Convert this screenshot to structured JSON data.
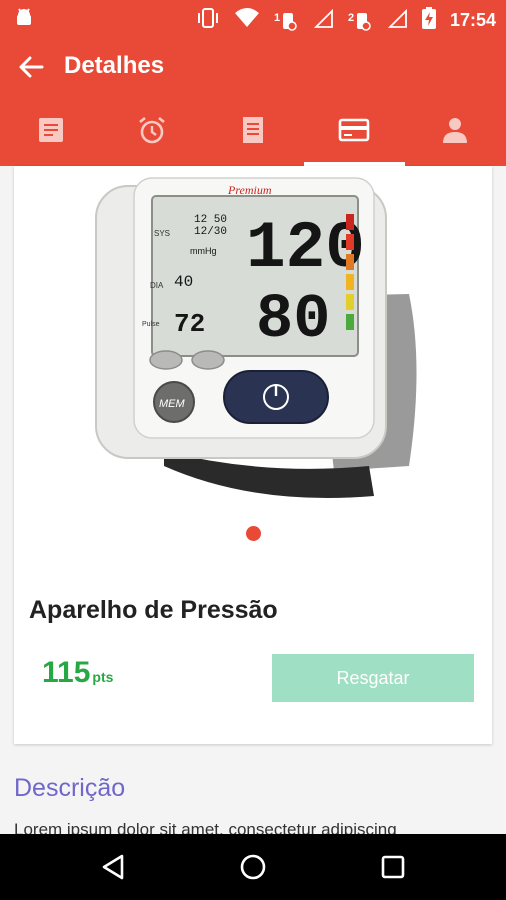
{
  "status_bar": {
    "time": "17:54",
    "sim1": "1",
    "sim2": "2",
    "icons": [
      "android-debug-icon",
      "vibrate-icon",
      "wifi-icon",
      "sim1-signal-icon",
      "sim2-signal-icon",
      "battery-charging-icon"
    ]
  },
  "app_bar": {
    "title": "Detalhes",
    "back_icon": "arrow-back-icon"
  },
  "tabs": [
    {
      "icon": "document-icon",
      "active": false
    },
    {
      "icon": "alarm-icon",
      "active": false
    },
    {
      "icon": "list-icon",
      "active": false
    },
    {
      "icon": "card-icon",
      "active": true
    },
    {
      "icon": "person-icon",
      "active": false
    }
  ],
  "product": {
    "name": "Aparelho de Pressão",
    "points_value": "115",
    "points_unit": "pts",
    "redeem_label": "Resgatar",
    "image_display": {
      "brand": "Premium",
      "sys_value": "120",
      "dia_value": "80",
      "pulse_value": "72",
      "date_line1": "12 50",
      "date_line2": "12/30",
      "unit": "mmHg",
      "mini_value": "40",
      "mem_label": "MEM",
      "label_sys": "SYS",
      "label_dia": "DIA",
      "label_pulse": "Pulse"
    }
  },
  "description": {
    "title": "Descrição",
    "text": "Lorem ipsum dolor sit amet, consectetur adipiscing"
  },
  "colors": {
    "primary": "#e84a37",
    "points": "#28a745",
    "button_disabled": "#9fdfc3",
    "section_title": "#7068c9"
  }
}
